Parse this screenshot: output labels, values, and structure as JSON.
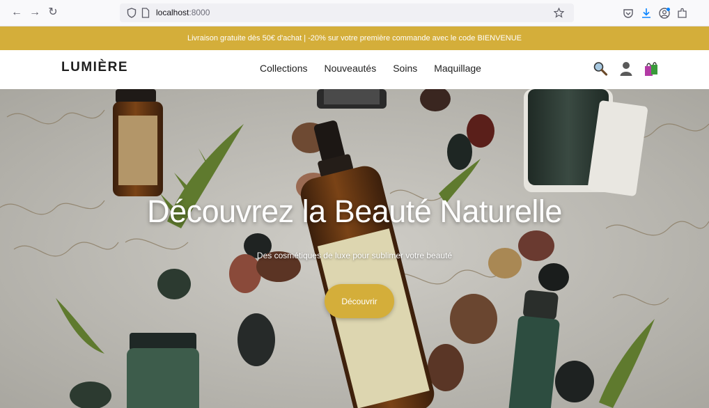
{
  "browser": {
    "url_host": "localhost",
    "url_port": ":8000"
  },
  "promo": {
    "text": "Livraison gratuite dès 50€ d'achat | -20% sur votre première commande avec le code BIENVENUE"
  },
  "header": {
    "logo": "LUMIÈRE",
    "nav": [
      "Collections",
      "Nouveautés",
      "Soins",
      "Maquillage"
    ]
  },
  "hero": {
    "title": "Découvrez la Beauté Naturelle",
    "subtitle": "Des cosmétiques de luxe pour sublimer votre beauté",
    "cta_label": "Découvrir"
  },
  "colors": {
    "accent": "#d4ae3a",
    "text_dark": "#1e1e1e",
    "hero_bg": "#bebcb6"
  },
  "icons": {
    "back": "arrow-left-icon",
    "forward": "arrow-right-icon",
    "reload": "reload-icon",
    "shield": "shield-icon",
    "page": "page-icon",
    "bookmark": "star-icon",
    "pocket": "pocket-icon",
    "download": "download-icon",
    "account": "account-icon",
    "extensions": "extensions-icon",
    "search": "search-icon",
    "user": "user-icon",
    "cart": "shopping-bag-icon"
  }
}
